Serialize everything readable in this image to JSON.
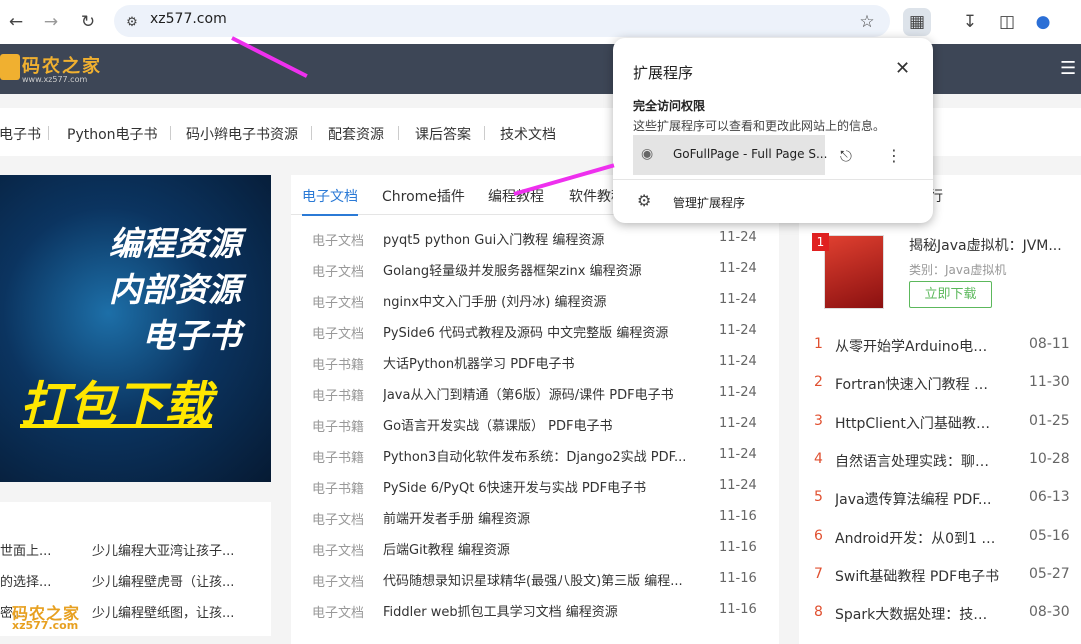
{
  "browser": {
    "url": "xz577.com",
    "icons": [
      "back-icon",
      "forward-icon",
      "reload-icon",
      "site-info-icon",
      "star-icon",
      "extensions-icon",
      "download-icon",
      "sidepanel-icon",
      "profile-icon"
    ]
  },
  "site": {
    "logo_title": "码农之家",
    "logo_sub": "www.xz577.com",
    "nav": [
      "电子书",
      "Python电子书",
      "码小辫电子书资源",
      "配套资源",
      "课后答案",
      "技术文档"
    ],
    "banner": {
      "line1": "编程资源",
      "line2": "内部资源",
      "line3": "电子书",
      "line4": "打包下载"
    },
    "left_list": [
      {
        "a": "世面上...",
        "b": "少儿编程大亚湾让孩子..."
      },
      {
        "a": "的选择...",
        "b": "少儿编程壁虎哥（让孩..."
      },
      {
        "a": "密...",
        "b": "少儿编程壁纸图，让孩..."
      }
    ],
    "watermark": {
      "title": "码农之家",
      "sub": "xz577.com"
    },
    "center": {
      "tabs": [
        "电子文档",
        "Chrome插件",
        "编程教程",
        "软件教程"
      ],
      "rows": [
        {
          "cat": "电子文档",
          "title": "pyqt5 python Gui入门教程 编程资源",
          "date": "11-24"
        },
        {
          "cat": "电子文档",
          "title": "Golang轻量级并发服务器框架zinx 编程资源",
          "date": "11-24"
        },
        {
          "cat": "电子文档",
          "title": "nginx中文入门手册 (刘丹冰) 编程资源",
          "date": "11-24"
        },
        {
          "cat": "电子文档",
          "title": "PySide6 代码式教程及源码 中文完整版 编程资源",
          "date": "11-24"
        },
        {
          "cat": "电子书籍",
          "title": "大话Python机器学习 PDF电子书",
          "date": "11-24"
        },
        {
          "cat": "电子书籍",
          "title": "Java从入门到精通（第6版）源码/课件 PDF电子书",
          "date": "11-24"
        },
        {
          "cat": "电子书籍",
          "title": "Go语言开发实战（慕课版） PDF电子书",
          "date": "11-24"
        },
        {
          "cat": "电子书籍",
          "title": "Python3自动化软件发布系统：Django2实战 PDF...",
          "date": "11-24"
        },
        {
          "cat": "电子书籍",
          "title": "PySide 6/PyQt 6快速开发与实战 PDF电子书",
          "date": "11-24"
        },
        {
          "cat": "电子文档",
          "title": "前端开发者手册 编程资源",
          "date": "11-16"
        },
        {
          "cat": "电子文档",
          "title": "后端Git教程 编程资源",
          "date": "11-16"
        },
        {
          "cat": "电子文档",
          "title": "代码随想录知识星球精华(最强八股文)第三版 编程...",
          "date": "11-16"
        },
        {
          "cat": "电子文档",
          "title": "Fiddler web抓包工具学习文档 编程资源",
          "date": "11-16"
        }
      ]
    },
    "right": {
      "tab": "行",
      "top": {
        "rank": "1",
        "title": "揭秘Java虚拟机：JVM...",
        "category": "类别：Java虚拟机",
        "download": "立即下载"
      },
      "rows": [
        {
          "rank": "1",
          "title": "从零开始学Arduino电子...",
          "date": "08-11"
        },
        {
          "rank": "2",
          "title": "Fortran快速入门教程 编...",
          "date": "11-30"
        },
        {
          "rank": "3",
          "title": "HttpClient入门基础教程...",
          "date": "01-25"
        },
        {
          "rank": "4",
          "title": "自然语言处理实践：聊天...",
          "date": "10-28"
        },
        {
          "rank": "5",
          "title": "Java遗传算法编程 PDF...",
          "date": "06-13"
        },
        {
          "rank": "6",
          "title": "Android开发：从0到1 P...",
          "date": "05-16"
        },
        {
          "rank": "7",
          "title": "Swift基础教程 PDF电子书",
          "date": "05-27"
        },
        {
          "rank": "8",
          "title": "Spark大数据处理：技术...",
          "date": "08-30"
        }
      ]
    }
  },
  "popup": {
    "title": "扩展程序",
    "section": "完全访问权限",
    "desc": "这些扩展程序可以查看和更改此网站上的信息。",
    "extension": "GoFullPage - Full Page S...",
    "manage": "管理扩展程序"
  },
  "colors": {
    "arrow": "#ee30ee",
    "accent": "#2b7ad6",
    "header": "#3d4656"
  }
}
